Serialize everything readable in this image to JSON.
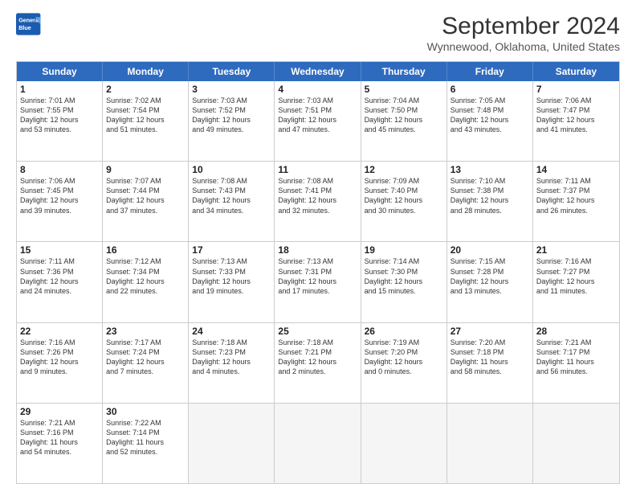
{
  "header": {
    "logo_line1": "General",
    "logo_line2": "Blue",
    "title": "September 2024",
    "subtitle": "Wynnewood, Oklahoma, United States"
  },
  "weekdays": [
    "Sunday",
    "Monday",
    "Tuesday",
    "Wednesday",
    "Thursday",
    "Friday",
    "Saturday"
  ],
  "rows": [
    [
      {
        "day": "1",
        "lines": [
          "Sunrise: 7:01 AM",
          "Sunset: 7:55 PM",
          "Daylight: 12 hours",
          "and 53 minutes."
        ]
      },
      {
        "day": "2",
        "lines": [
          "Sunrise: 7:02 AM",
          "Sunset: 7:54 PM",
          "Daylight: 12 hours",
          "and 51 minutes."
        ]
      },
      {
        "day": "3",
        "lines": [
          "Sunrise: 7:03 AM",
          "Sunset: 7:52 PM",
          "Daylight: 12 hours",
          "and 49 minutes."
        ]
      },
      {
        "day": "4",
        "lines": [
          "Sunrise: 7:03 AM",
          "Sunset: 7:51 PM",
          "Daylight: 12 hours",
          "and 47 minutes."
        ]
      },
      {
        "day": "5",
        "lines": [
          "Sunrise: 7:04 AM",
          "Sunset: 7:50 PM",
          "Daylight: 12 hours",
          "and 45 minutes."
        ]
      },
      {
        "day": "6",
        "lines": [
          "Sunrise: 7:05 AM",
          "Sunset: 7:48 PM",
          "Daylight: 12 hours",
          "and 43 minutes."
        ]
      },
      {
        "day": "7",
        "lines": [
          "Sunrise: 7:06 AM",
          "Sunset: 7:47 PM",
          "Daylight: 12 hours",
          "and 41 minutes."
        ]
      }
    ],
    [
      {
        "day": "8",
        "lines": [
          "Sunrise: 7:06 AM",
          "Sunset: 7:45 PM",
          "Daylight: 12 hours",
          "and 39 minutes."
        ]
      },
      {
        "day": "9",
        "lines": [
          "Sunrise: 7:07 AM",
          "Sunset: 7:44 PM",
          "Daylight: 12 hours",
          "and 37 minutes."
        ]
      },
      {
        "day": "10",
        "lines": [
          "Sunrise: 7:08 AM",
          "Sunset: 7:43 PM",
          "Daylight: 12 hours",
          "and 34 minutes."
        ]
      },
      {
        "day": "11",
        "lines": [
          "Sunrise: 7:08 AM",
          "Sunset: 7:41 PM",
          "Daylight: 12 hours",
          "and 32 minutes."
        ]
      },
      {
        "day": "12",
        "lines": [
          "Sunrise: 7:09 AM",
          "Sunset: 7:40 PM",
          "Daylight: 12 hours",
          "and 30 minutes."
        ]
      },
      {
        "day": "13",
        "lines": [
          "Sunrise: 7:10 AM",
          "Sunset: 7:38 PM",
          "Daylight: 12 hours",
          "and 28 minutes."
        ]
      },
      {
        "day": "14",
        "lines": [
          "Sunrise: 7:11 AM",
          "Sunset: 7:37 PM",
          "Daylight: 12 hours",
          "and 26 minutes."
        ]
      }
    ],
    [
      {
        "day": "15",
        "lines": [
          "Sunrise: 7:11 AM",
          "Sunset: 7:36 PM",
          "Daylight: 12 hours",
          "and 24 minutes."
        ]
      },
      {
        "day": "16",
        "lines": [
          "Sunrise: 7:12 AM",
          "Sunset: 7:34 PM",
          "Daylight: 12 hours",
          "and 22 minutes."
        ]
      },
      {
        "day": "17",
        "lines": [
          "Sunrise: 7:13 AM",
          "Sunset: 7:33 PM",
          "Daylight: 12 hours",
          "and 19 minutes."
        ]
      },
      {
        "day": "18",
        "lines": [
          "Sunrise: 7:13 AM",
          "Sunset: 7:31 PM",
          "Daylight: 12 hours",
          "and 17 minutes."
        ]
      },
      {
        "day": "19",
        "lines": [
          "Sunrise: 7:14 AM",
          "Sunset: 7:30 PM",
          "Daylight: 12 hours",
          "and 15 minutes."
        ]
      },
      {
        "day": "20",
        "lines": [
          "Sunrise: 7:15 AM",
          "Sunset: 7:28 PM",
          "Daylight: 12 hours",
          "and 13 minutes."
        ]
      },
      {
        "day": "21",
        "lines": [
          "Sunrise: 7:16 AM",
          "Sunset: 7:27 PM",
          "Daylight: 12 hours",
          "and 11 minutes."
        ]
      }
    ],
    [
      {
        "day": "22",
        "lines": [
          "Sunrise: 7:16 AM",
          "Sunset: 7:26 PM",
          "Daylight: 12 hours",
          "and 9 minutes."
        ]
      },
      {
        "day": "23",
        "lines": [
          "Sunrise: 7:17 AM",
          "Sunset: 7:24 PM",
          "Daylight: 12 hours",
          "and 7 minutes."
        ]
      },
      {
        "day": "24",
        "lines": [
          "Sunrise: 7:18 AM",
          "Sunset: 7:23 PM",
          "Daylight: 12 hours",
          "and 4 minutes."
        ]
      },
      {
        "day": "25",
        "lines": [
          "Sunrise: 7:18 AM",
          "Sunset: 7:21 PM",
          "Daylight: 12 hours",
          "and 2 minutes."
        ]
      },
      {
        "day": "26",
        "lines": [
          "Sunrise: 7:19 AM",
          "Sunset: 7:20 PM",
          "Daylight: 12 hours",
          "and 0 minutes."
        ]
      },
      {
        "day": "27",
        "lines": [
          "Sunrise: 7:20 AM",
          "Sunset: 7:18 PM",
          "Daylight: 11 hours",
          "and 58 minutes."
        ]
      },
      {
        "day": "28",
        "lines": [
          "Sunrise: 7:21 AM",
          "Sunset: 7:17 PM",
          "Daylight: 11 hours",
          "and 56 minutes."
        ]
      }
    ],
    [
      {
        "day": "29",
        "lines": [
          "Sunrise: 7:21 AM",
          "Sunset: 7:16 PM",
          "Daylight: 11 hours",
          "and 54 minutes."
        ]
      },
      {
        "day": "30",
        "lines": [
          "Sunrise: 7:22 AM",
          "Sunset: 7:14 PM",
          "Daylight: 11 hours",
          "and 52 minutes."
        ]
      },
      {
        "day": "",
        "lines": []
      },
      {
        "day": "",
        "lines": []
      },
      {
        "day": "",
        "lines": []
      },
      {
        "day": "",
        "lines": []
      },
      {
        "day": "",
        "lines": []
      }
    ]
  ]
}
